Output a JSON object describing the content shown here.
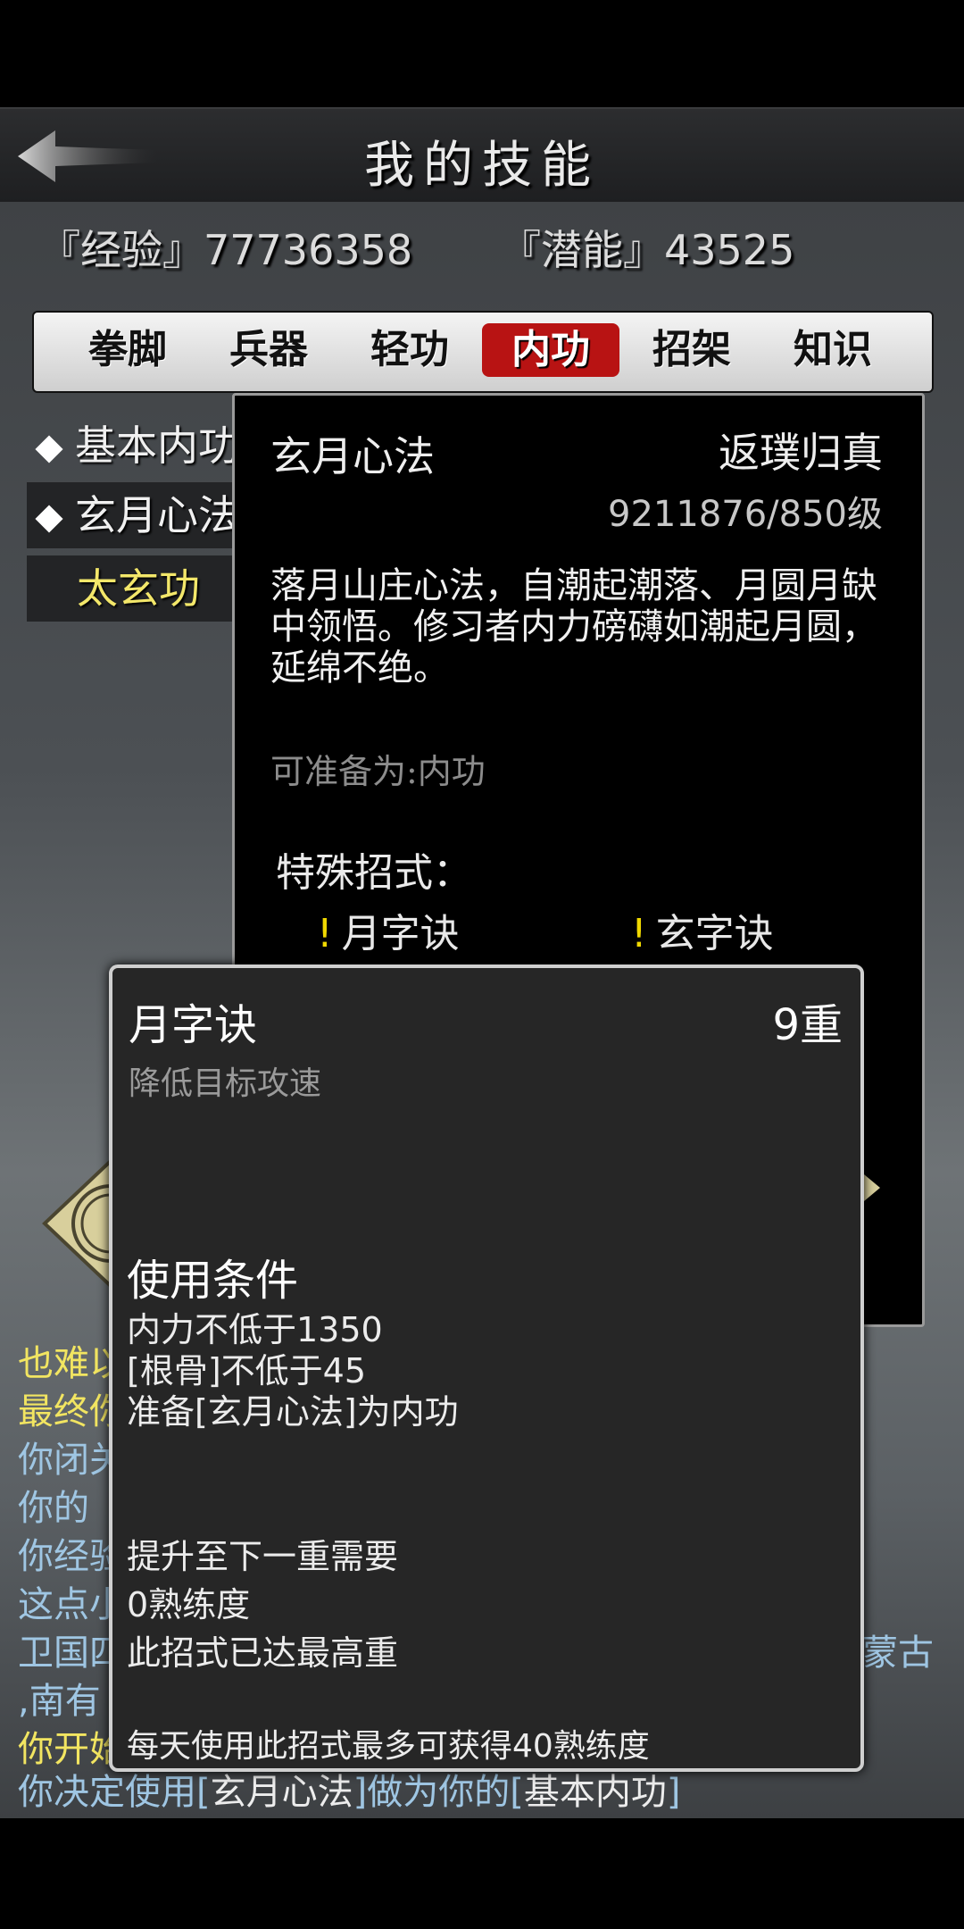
{
  "header": {
    "title": "我的技能",
    "back_icon": "back-arrow-icon"
  },
  "stats": {
    "exp": "『经验』77736358",
    "potential": "『潜能』43525"
  },
  "tabs": [
    {
      "label": "拳脚",
      "active": false
    },
    {
      "label": "兵器",
      "active": false
    },
    {
      "label": "轻功",
      "active": false
    },
    {
      "label": "内功",
      "active": true
    },
    {
      "label": "招架",
      "active": false
    },
    {
      "label": "知识",
      "active": false
    }
  ],
  "skills": [
    {
      "label": "基本内功"
    },
    {
      "label": "玄月心法"
    },
    {
      "label": "太玄功"
    }
  ],
  "detail": {
    "name": "玄月心法",
    "rank": "返璞归真",
    "level": "9211876/850级",
    "description": "落月山庄心法，自潮起潮落、月圆月缺中领悟。修习者内力磅礴如潮起月圆，延绵不绝。",
    "prepare": "可准备为:内功",
    "special_title": "特殊招式：",
    "special_moves": [
      {
        "mark": "!",
        "label": "月字诀"
      },
      {
        "mark": "!",
        "label": "玄字诀"
      }
    ]
  },
  "popup": {
    "name": "月字诀",
    "level": "9重",
    "effect": "降低目标攻速",
    "conditions_title": "使用条件",
    "conditions": [
      "内力不低于1350",
      "[根骨]不低于45",
      "准备[玄月心法]为内功"
    ],
    "upgrade": [
      "提升至下一重需要",
      "0熟练度",
      "此招式已达最高重"
    ],
    "daily": "每天使用此招式最多可获得40熟练度"
  },
  "log": {
    "lines_left": [
      {
        "text": "也难以",
        "color": "yellow"
      },
      {
        "text": "最终你",
        "color": "yellow"
      },
      {
        "text": "你闭关",
        "color": "blue"
      },
      {
        "text": "你的",
        "color": "blue"
      },
      {
        "text": "你经验",
        "color": "blue"
      },
      {
        "text": "这点小",
        "color": "blue"
      },
      {
        "text": "卫国四",
        "color": "blue"
      },
      {
        "text": ",南有",
        "color": "blue"
      },
      {
        "text": "你开始",
        "color": "yellow"
      }
    ],
    "right_fragment": "蒙古",
    "final": {
      "pre": "你决定使用[",
      "skill_a": "玄月心法",
      "mid": "]做为你的[",
      "skill_b": "基本内功",
      "post": "]"
    }
  },
  "colors": {
    "accent_tab": "#b81313",
    "log_yellow": "#f2e561",
    "log_blue": "#9fc6e3",
    "special_mark": "#f0d800"
  }
}
